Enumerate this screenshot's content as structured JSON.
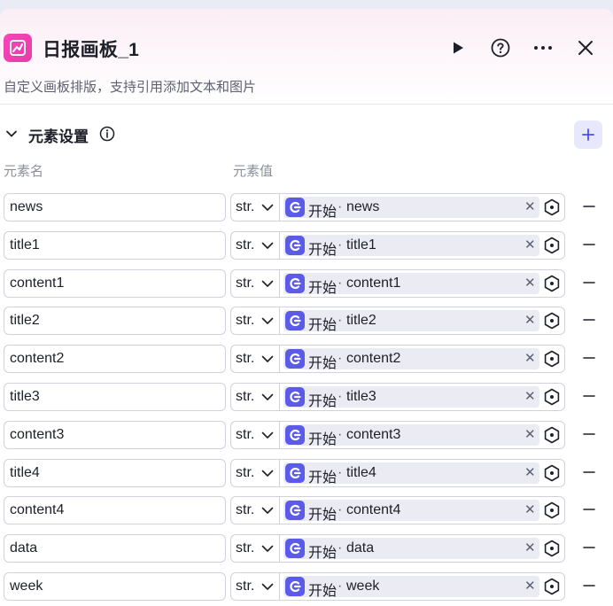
{
  "header": {
    "title": "日报画板_1",
    "description": "自定义画板排版，支持引用添加文本和图片",
    "accent": "#f547b8"
  },
  "section": {
    "title": "元素设置",
    "columns": {
      "name": "元素名",
      "value": "元素值"
    }
  },
  "icons": {
    "run": "play-icon",
    "help": "help-circle-icon",
    "more": "more-horizontal-icon",
    "close": "close-icon",
    "info": "info-icon",
    "add": "plus-icon",
    "remove": "minus-icon",
    "picker": "variable-picker-icon",
    "ref": "node-start-icon"
  },
  "rows": [
    {
      "name": "news",
      "type": "str.",
      "node": "开始",
      "field": "news"
    },
    {
      "name": "title1",
      "type": "str.",
      "node": "开始",
      "field": "title1"
    },
    {
      "name": "content1",
      "type": "str.",
      "node": "开始",
      "field": "content1"
    },
    {
      "name": "title2",
      "type": "str.",
      "node": "开始",
      "field": "title2"
    },
    {
      "name": "content2",
      "type": "str.",
      "node": "开始",
      "field": "content2"
    },
    {
      "name": "title3",
      "type": "str.",
      "node": "开始",
      "field": "title3"
    },
    {
      "name": "content3",
      "type": "str.",
      "node": "开始",
      "field": "content3"
    },
    {
      "name": "title4",
      "type": "str.",
      "node": "开始",
      "field": "title4"
    },
    {
      "name": "content4",
      "type": "str.",
      "node": "开始",
      "field": "content4"
    },
    {
      "name": "data",
      "type": "str.",
      "node": "开始",
      "field": "data"
    },
    {
      "name": "week",
      "type": "str.",
      "node": "开始",
      "field": "week"
    }
  ],
  "colors": {
    "ref_icon": "#5b5be8",
    "add_bg": "#e7e8fb",
    "tag_bg": "#ebebf4"
  }
}
